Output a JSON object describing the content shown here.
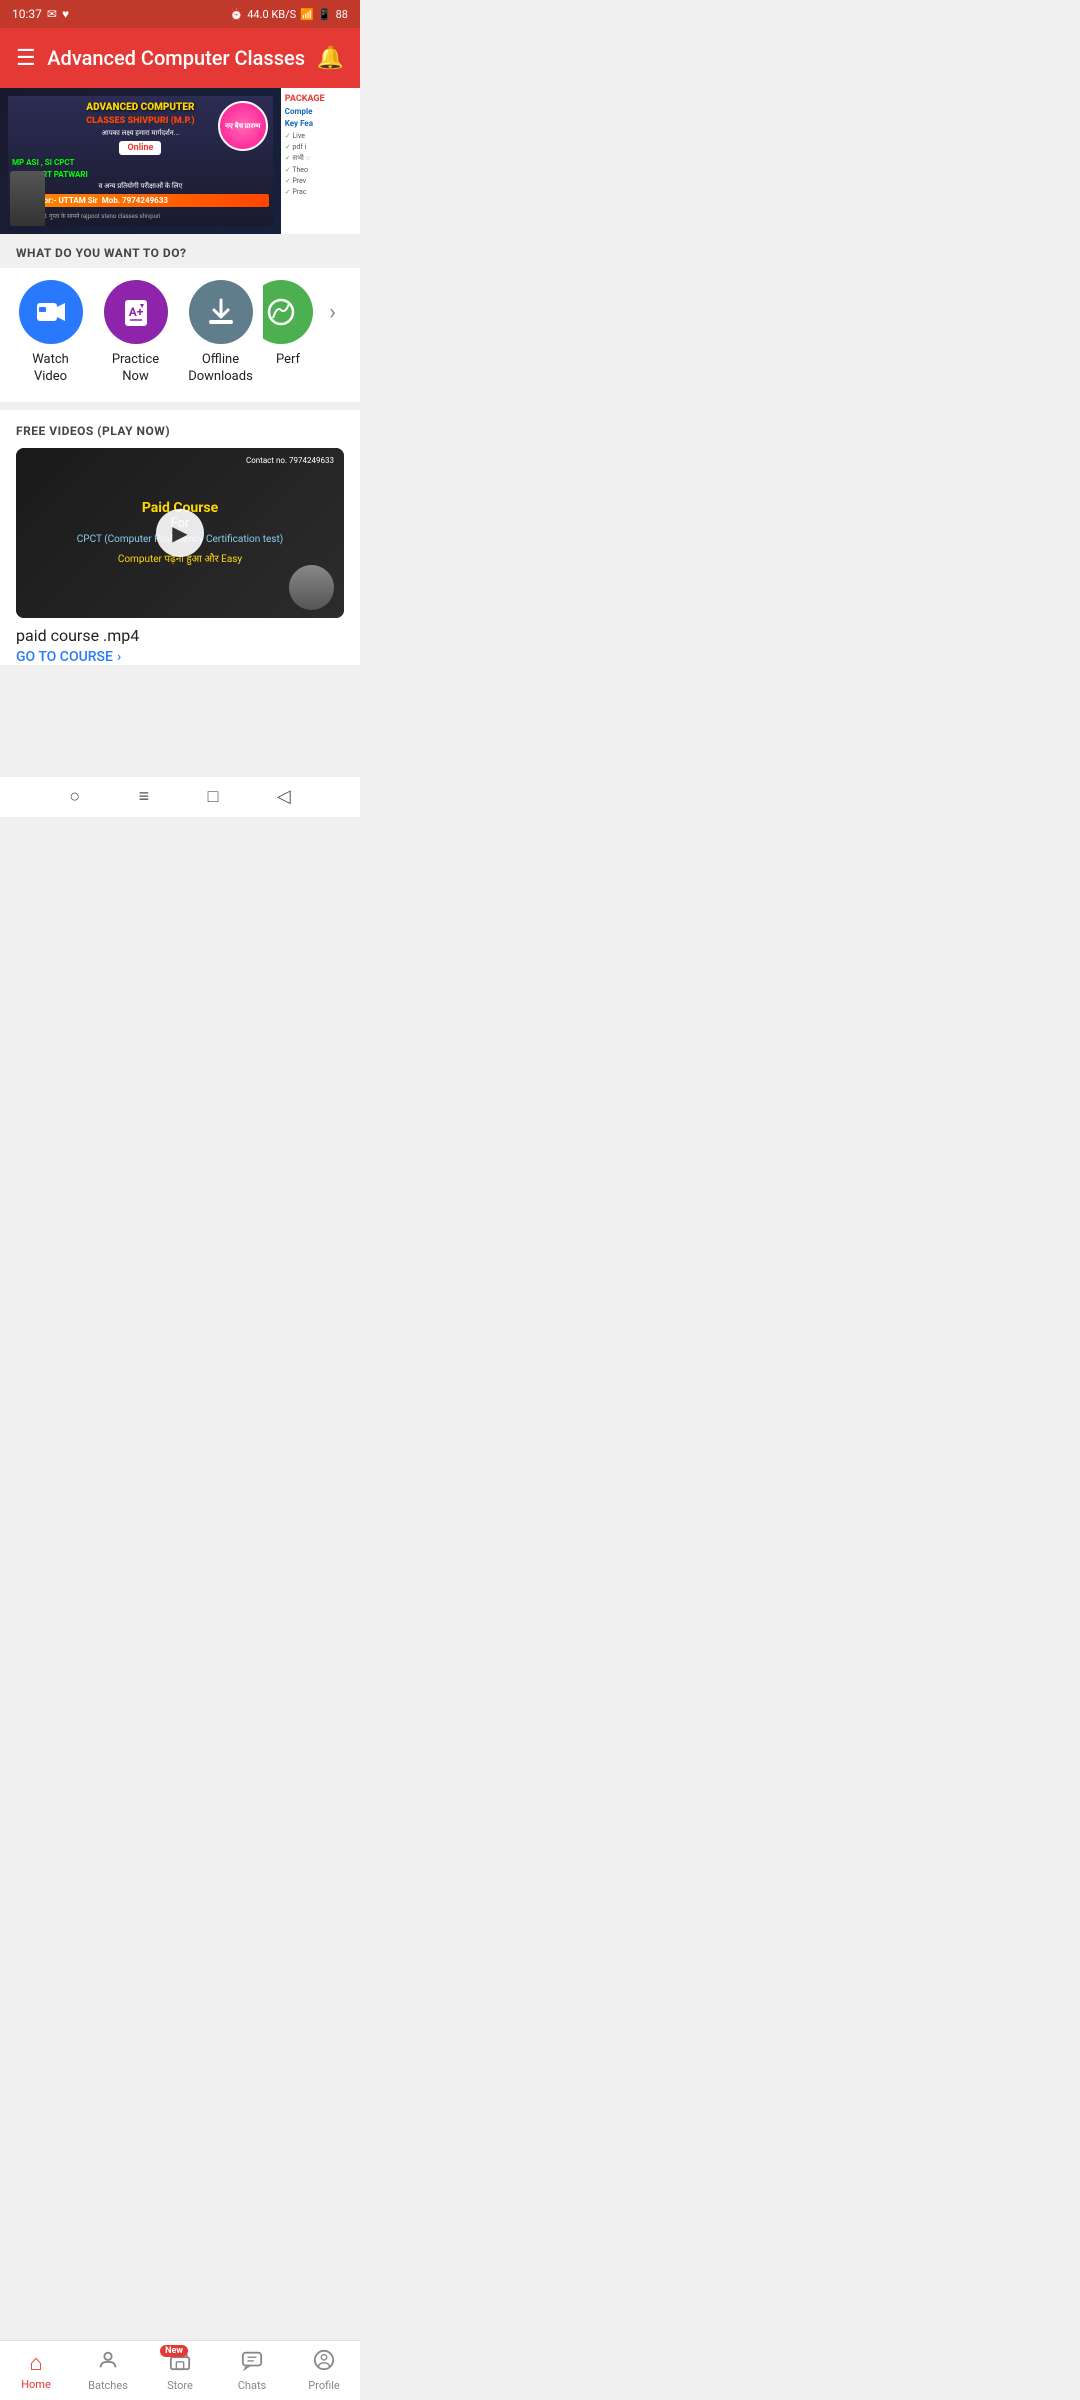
{
  "statusBar": {
    "time": "10:37",
    "network": "44.0 KB/S",
    "battery": "88"
  },
  "header": {
    "title": "Advanced Computer Classes",
    "hamburger_icon": "☰",
    "bell_icon": "🔔"
  },
  "banner": {
    "line1": "ADVANCED COMPUTER",
    "line2": "CLASSES SHIVPURI (M.P.)",
    "subtitle": "आपका लक्ष्य हमारा मार्गदर्शन...",
    "online_label": "Online",
    "courses": "MP ASI , SI   CPCT",
    "courses2": "MP COURT  PATWARI",
    "more_text": "व अन्य प्रतियोगी परीक्षाओं के लिए",
    "director_label": ":-Director:-",
    "director_name": "UTTAM Sir",
    "mobile": "Mob. 7974249633",
    "address": "पता- डॉ. एम. डी. गुप्ता के सामने rajpoot steno classes shivpuri",
    "new_batch": "नए बैच प्रारम्भ",
    "package_label": "PACKAGE",
    "complete_label": "Comple",
    "key_features": "Key Fea",
    "features": [
      "Live",
      "pdf i",
      "सभी ◌",
      "Theo",
      "Prev",
      "Prac"
    ]
  },
  "whatToDo": {
    "label": "WHAT DO YOU WANT TO DO?"
  },
  "actions": [
    {
      "id": "watch-video",
      "label": "Watch\nVideo",
      "icon": "📹",
      "color": "blue"
    },
    {
      "id": "practice-now",
      "label": "Practice\nNow",
      "icon": "📝",
      "color": "purple"
    },
    {
      "id": "offline-downloads",
      "label": "Offline\nDownloads",
      "icon": "⬇",
      "color": "gray"
    },
    {
      "id": "performance",
      "label": "Perf",
      "icon": "🟢",
      "color": "green"
    }
  ],
  "freeVideos": {
    "label": "FREE VIDEOS (PLAY NOW)",
    "video": {
      "contact": "Contact no. 7974249633",
      "text_paid": "Paid Course",
      "text_for": "For",
      "text_cpct": "CPCT (Computer Proficiency Certification test)",
      "text_easy": "Computer पढ़ना हुआ और Easy",
      "title": "paid course .mp4",
      "go_to_course": "GO TO COURSE"
    }
  },
  "bottomNav": [
    {
      "id": "home",
      "label": "Home",
      "icon": "⌂",
      "active": true
    },
    {
      "id": "batches",
      "label": "Batches",
      "icon": "👤",
      "active": false
    },
    {
      "id": "store",
      "label": "Store",
      "icon": "🏪",
      "active": false,
      "badge": "New"
    },
    {
      "id": "chats",
      "label": "Chats",
      "icon": "💬",
      "active": false
    },
    {
      "id": "profile",
      "label": "Profile",
      "icon": "○",
      "active": false
    }
  ],
  "systemNav": {
    "circle": "○",
    "lines": "≡",
    "square": "□",
    "back": "◁"
  }
}
